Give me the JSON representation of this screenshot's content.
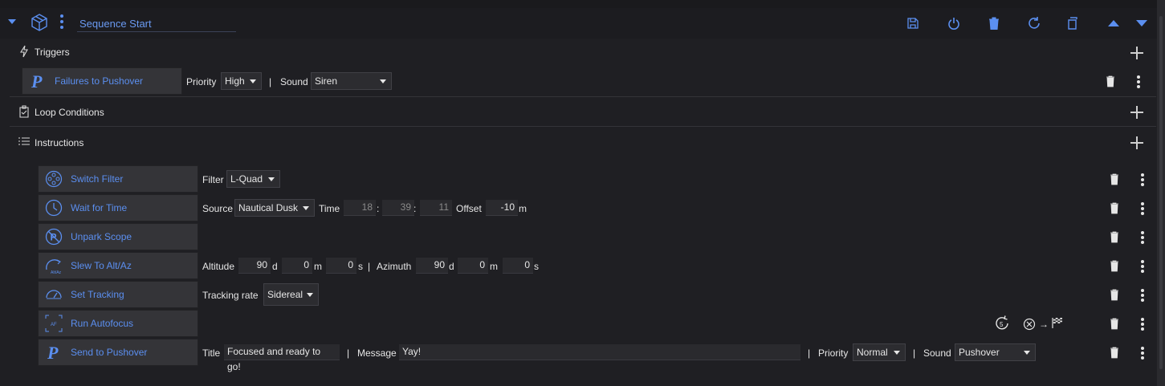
{
  "header": {
    "title": "Sequence Start"
  },
  "triggers": {
    "label": "Triggers",
    "items": [
      {
        "name": "Failures to Pushover",
        "priority_label": "Priority",
        "priority": "High",
        "sep": "|",
        "sound_label": "Sound",
        "sound": "Siren"
      }
    ]
  },
  "loop": {
    "label": "Loop Conditions"
  },
  "instructions": {
    "label": "Instructions",
    "items": [
      {
        "name": "Switch Filter"
      },
      {
        "name": "Wait for Time"
      },
      {
        "name": "Unpark Scope"
      },
      {
        "name": "Slew To Alt/Az"
      },
      {
        "name": "Set Tracking"
      },
      {
        "name": "Run Autofocus"
      },
      {
        "name": "Send to Pushover"
      }
    ]
  },
  "switch_filter": {
    "label": "Filter",
    "value": "L-Quad"
  },
  "wait_time": {
    "source_label": "Source",
    "source": "Nautical Dusk",
    "time_label": "Time",
    "h": "18",
    "m": "39",
    "s": "11",
    "colon": ":",
    "offset_label": "Offset",
    "offset": "-10",
    "offset_unit": "m"
  },
  "slew": {
    "alt_label": "Altitude",
    "alt_d": "90",
    "alt_m": "0",
    "alt_s": "0",
    "d": "d",
    "m": "m",
    "s": "s",
    "sep": "|",
    "az_label": "Azimuth",
    "az_d": "90",
    "az_m": "0",
    "az_s": "0"
  },
  "tracking": {
    "label": "Tracking rate",
    "value": "Sidereal"
  },
  "autofocus": {
    "arrow": "→",
    "badge": "5"
  },
  "pushover": {
    "title_label": "Title",
    "title": "Focused and ready to go!",
    "sep": "|",
    "message_label": "Message",
    "message": "Yay!",
    "priority_label": "Priority",
    "priority": "Normal",
    "sound_label": "Sound",
    "sound": "Pushover"
  },
  "icons": {
    "accent": "#5b8ff0"
  }
}
